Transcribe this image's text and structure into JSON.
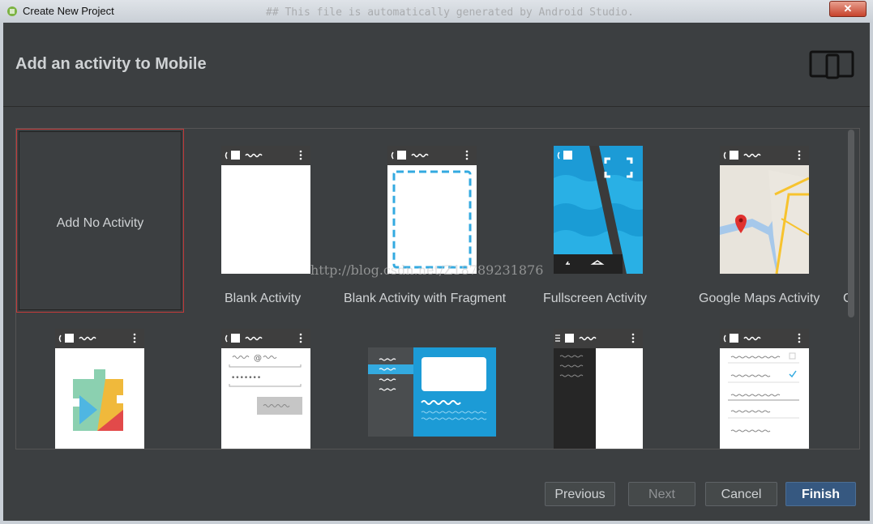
{
  "window": {
    "title": "Create New Project",
    "background_code_text": "## This file is automatically generated by Android Studio.",
    "close_label": "✕"
  },
  "header": {
    "title": "Add an activity to Mobile",
    "device_icon": "phone-tablet-icon"
  },
  "gallery": {
    "items": [
      {
        "label": "Add No Activity",
        "selected": true
      },
      {
        "label": "Blank Activity"
      },
      {
        "label": "Blank Activity with Fragment"
      },
      {
        "label": "Fullscreen Activity"
      },
      {
        "label": "Google Maps Activity"
      },
      {
        "label": "G"
      }
    ],
    "row2": [
      {
        "preview": "google-play-services-icon"
      },
      {
        "preview": "login-activity-preview"
      },
      {
        "preview": "master-detail-flow-preview"
      },
      {
        "preview": "navigation-drawer-preview"
      },
      {
        "preview": "settings-activity-preview"
      }
    ]
  },
  "watermark": "http://blog.csdn.net/Z18789231876",
  "footer": {
    "previous": "Previous",
    "next": "Next",
    "cancel": "Cancel",
    "finish": "Finish"
  },
  "colors": {
    "accent": "#365880",
    "selection": "#c23a3a",
    "thumb_blue": "#33aae0"
  }
}
